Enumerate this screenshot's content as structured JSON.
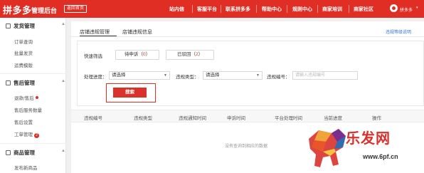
{
  "header": {
    "brand": "拼多多",
    "subtitle": "管理后台",
    "home_button": "返回首页",
    "nav": [
      "站内信",
      "客服平台",
      "联系拼多多",
      "帮助中心",
      "规则中心",
      "商家培训",
      "商家社区"
    ],
    "user_name": "拼多多",
    "brand_color": "#e02e24"
  },
  "sidebar": {
    "groups": [
      {
        "title": "发货管理",
        "items": [
          "订单查询",
          "批量发货",
          "运费模版"
        ]
      },
      {
        "title": "售后管理",
        "items": [
          "退款/售后",
          "售后服务数量",
          "售后设置",
          "工单管理"
        ]
      },
      {
        "title": "商品管理",
        "items": [
          "发布新商品"
        ]
      }
    ],
    "workorder_badge": "2"
  },
  "tabs": [
    "店铺违规管理",
    "店铺违规信息"
  ],
  "rules_link": "违规等级说明",
  "filters": {
    "quick_label": "快速筛选",
    "pending_label": "待申诉（",
    "pending_count": "0",
    "pending_close": "）",
    "rejected_label": "已驳回（",
    "rejected_count": "2",
    "rejected_close": "）",
    "progress_label": "处理进度：",
    "progress_value": "请选择",
    "type_label": "违规类型：",
    "type_value": "请选择",
    "id_label": "违规编号：",
    "id_placeholder": "请输入违规编号",
    "search_button": "搜索"
  },
  "table": {
    "columns": [
      "违规编号",
      "违规类型",
      "违规通知时间",
      "申诉时间",
      "平台处理时间",
      "当前进度",
      "操作"
    ],
    "empty_text": "没有查询到相应的数据"
  },
  "watermark": {
    "text": "乐发网",
    "url": "www.6pf.cn"
  }
}
